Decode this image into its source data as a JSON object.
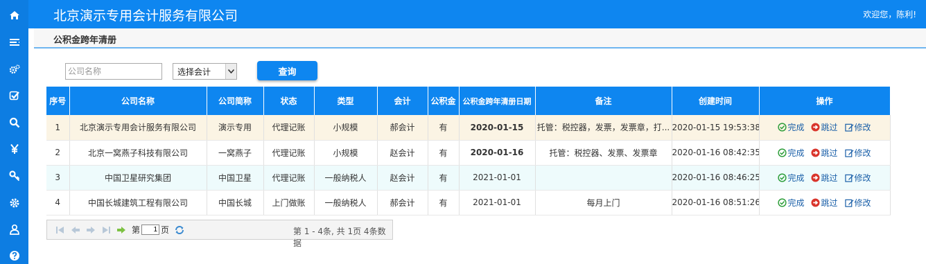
{
  "app": {
    "title": "北京演示专用会计服务有限公司",
    "welcome": "欢迎您，陈利!"
  },
  "page": {
    "title": "公积金跨年清册"
  },
  "sidebar": {
    "icons": [
      "home-icon",
      "list-icon",
      "settings-icon",
      "check-icon",
      "search-icon",
      "yen-icon",
      "key-icon",
      "gear-icon",
      "user-icon",
      "help-icon"
    ]
  },
  "filters": {
    "company_placeholder": "公司名称",
    "accountant_select": "选择会计",
    "query_label": "查询"
  },
  "table": {
    "headers": [
      "序号",
      "公司名称",
      "公司简称",
      "状态",
      "类型",
      "会计",
      "公积金",
      "公积金跨年清册日期",
      "备注",
      "创建时间",
      "操作"
    ],
    "rows": [
      {
        "no": "1",
        "company": "北京演示专用会计服务有限公司",
        "short": "演示专用",
        "status": "代理记账",
        "type": "小规模",
        "accountant": "郝会计",
        "fund": "有",
        "date": "2020-01-15",
        "date_red": true,
        "note": "托管：税控器，发票，发票章，打...",
        "created": "2020-01-15 19:53:38"
      },
      {
        "no": "2",
        "company": "北京一窝燕子科技有限公司",
        "short": "一窝燕子",
        "status": "代理记账",
        "type": "小规模",
        "accountant": "赵会计",
        "fund": "有",
        "date": "2020-01-16",
        "date_red": true,
        "note": "托管：税控器、发票、发票章",
        "created": "2020-01-16 08:42:35"
      },
      {
        "no": "3",
        "company": "中国卫星研究集团",
        "short": "中国卫星",
        "status": "代理记账",
        "type": "一般纳税人",
        "accountant": "赵会计",
        "fund": "有",
        "date": "2021-01-01",
        "date_red": false,
        "note": "",
        "created": "2020-01-16 08:46:25"
      },
      {
        "no": "4",
        "company": "中国长城建筑工程有限公司",
        "short": "中国长城",
        "status": "上门做账",
        "type": "一般纳税人",
        "accountant": "郝会计",
        "fund": "有",
        "date": "2021-01-01",
        "date_red": false,
        "note": "每月上门",
        "created": "2020-01-16 08:51:26"
      }
    ],
    "actions": {
      "complete": "完成",
      "skip": "跳过",
      "edit": "修改"
    }
  },
  "pager": {
    "page_prefix": "第",
    "page_value": "1",
    "page_suffix": "页",
    "summary": "第 1 - 4条, 共 1页 4条数据"
  },
  "colors": {
    "primary": "#0e86f0",
    "sidebar": "#0d7de2",
    "red_date": "#e00000",
    "complete_green": "#2e9e3a",
    "skip_red": "#d9342b",
    "action_blue": "#1a5fa8"
  }
}
